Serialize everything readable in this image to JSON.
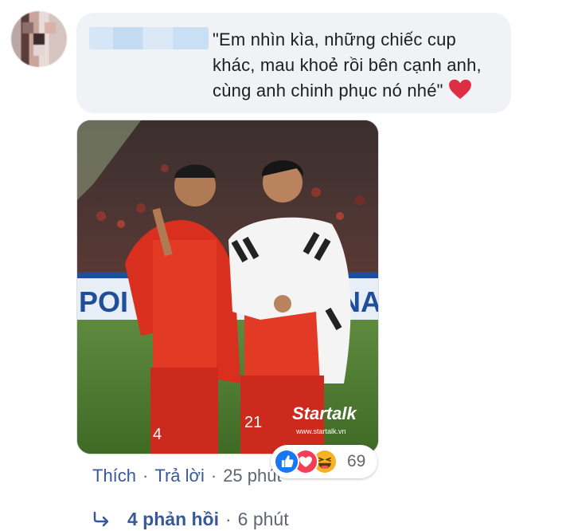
{
  "comment": {
    "text": "\"Em nhìn kìa, những chiếc cup khác, mau khoẻ rồi bên cạnh anh, cùng anh chinh phục nó nhé\"",
    "emoji": "heart-icon"
  },
  "photo": {
    "watermark_brand": "Startalk",
    "watermark_url": "www.startalk.vn",
    "left_player_number": "4",
    "right_player_number": "21",
    "banner_text_left": "POI",
    "banner_text_right": "NA"
  },
  "actions": {
    "like_label": "Thích",
    "separator": "·",
    "reply_label": "Trả lời",
    "time": "25 phút"
  },
  "reactions": {
    "icons": [
      "like-icon",
      "love-icon",
      "haha-icon"
    ],
    "count": "69",
    "colors": {
      "like": "#1877f2",
      "love": "#f33e58",
      "haha": "#f7b125"
    }
  },
  "replies": {
    "label": "4 phản hồi",
    "separator": "·",
    "time": "6 phút"
  }
}
